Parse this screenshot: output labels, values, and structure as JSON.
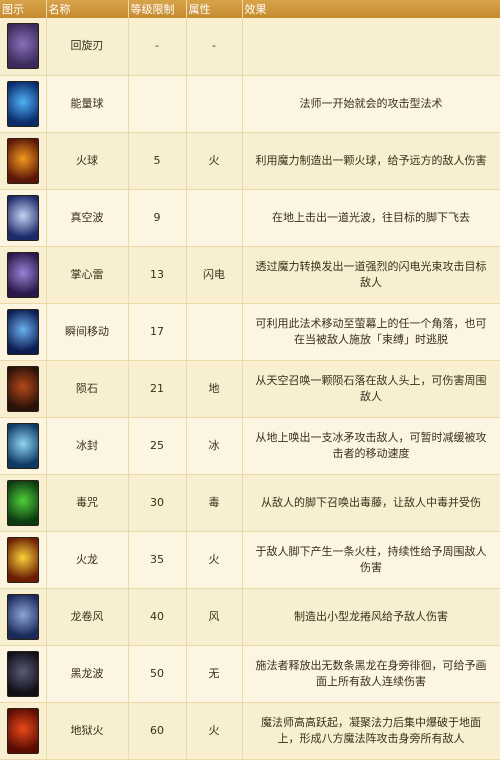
{
  "headers": [
    "图示",
    "名称",
    "等级限制",
    "属性",
    "效果"
  ],
  "skills": [
    {
      "icon": "spiral-blade-icon",
      "colors": [
        "#3b2a5a",
        "#8a6fb8"
      ],
      "name": "回旋刃",
      "level": "-",
      "attr": "-",
      "effect": ""
    },
    {
      "icon": "energy-orb-icon",
      "colors": [
        "#0a2a6a",
        "#4fb0f5"
      ],
      "name": "能量球",
      "level": "",
      "attr": "",
      "effect": "法师一开始就会的攻击型法术"
    },
    {
      "icon": "fireball-icon",
      "colors": [
        "#5a1608",
        "#f39a1e"
      ],
      "name": "火球",
      "level": "5",
      "attr": "火",
      "effect": "利用魔力制造出一颗火球，给予远方的敌人伤害"
    },
    {
      "icon": "vacuum-wave-icon",
      "colors": [
        "#1c2a6a",
        "#c6d3f2"
      ],
      "name": "真空波",
      "level": "9",
      "attr": "",
      "effect": "在地上击出一道光波，往目标的脚下飞去"
    },
    {
      "icon": "palm-thunder-icon",
      "colors": [
        "#2a1848",
        "#9a82d8"
      ],
      "name": "掌心雷",
      "level": "13",
      "attr": "闪电",
      "effect": "透过魔力转换发出一道强烈的闪电光束攻击目标敌人"
    },
    {
      "icon": "teleport-icon",
      "colors": [
        "#0c1c52",
        "#6ab0f0"
      ],
      "name": "瞬间移动",
      "level": "17",
      "attr": "",
      "effect": "可利用此法术移动至萤幕上的任一个角落，也可在当被敌人施放「束缚」时逃脱"
    },
    {
      "icon": "meteor-icon",
      "colors": [
        "#2a1208",
        "#b4481a"
      ],
      "name": "陨石",
      "level": "21",
      "attr": "地",
      "effect": "从天空召唤一颗陨石落在敌人头上，可伤害周围敌人"
    },
    {
      "icon": "ice-seal-icon",
      "colors": [
        "#0e3a62",
        "#8fd6f2"
      ],
      "name": "冰封",
      "level": "25",
      "attr": "冰",
      "effect": "从地上唤出一支冰矛攻击敌人，可暂时减缓被攻击者的移动速度"
    },
    {
      "icon": "poison-curse-icon",
      "colors": [
        "#0c3a10",
        "#4fcf3a"
      ],
      "name": "毒咒",
      "level": "30",
      "attr": "毒",
      "effect": "从敌人的脚下召唤出毒藤，让敌人中毒并受伤"
    },
    {
      "icon": "fire-dragon-icon",
      "colors": [
        "#6a1e04",
        "#fcd23a"
      ],
      "name": "火龙",
      "level": "35",
      "attr": "火",
      "effect": "于敌人脚下产生一条火柱，持续性给予周围敌人伤害"
    },
    {
      "icon": "tornado-icon",
      "colors": [
        "#1a2a58",
        "#8ea6d6"
      ],
      "name": "龙卷风",
      "level": "40",
      "attr": "风",
      "effect": "制造出小型龙捲风给予敌人伤害"
    },
    {
      "icon": "black-dragon-wave-icon",
      "colors": [
        "#101018",
        "#5a5a78"
      ],
      "name": "黑龙波",
      "level": "50",
      "attr": "无",
      "effect": "施法者释放出无数条黑龙在身旁徘徊，可给予画面上所有敌人连续伤害"
    },
    {
      "icon": "hellfire-icon",
      "colors": [
        "#5a0c04",
        "#e84a18"
      ],
      "name": "地狱火",
      "level": "60",
      "attr": "火",
      "effect": "魔法师高高跃起，凝聚法力后集中爆破于地面上，形成八方魔法阵攻击身旁所有敌人"
    }
  ]
}
